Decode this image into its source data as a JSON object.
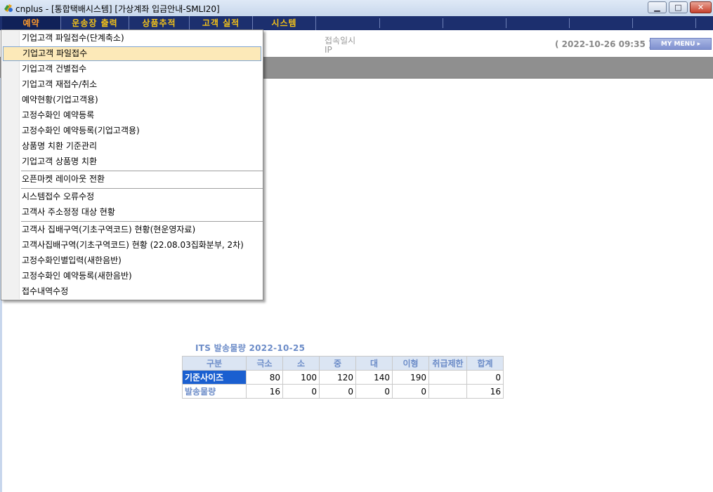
{
  "window": {
    "title": "cnplus - [통합택배시스템] [가상계좌 입금안내-SMLI20]",
    "min_glyph": "▁",
    "max_glyph": "□",
    "close_glyph": "✕"
  },
  "menubar": {
    "items": [
      "예약",
      "운송장 출력",
      "상품추적",
      "고객 실적",
      "시스템"
    ],
    "active": "예약"
  },
  "infobar": {
    "access_label": "접속일시",
    "ip_label": "IP",
    "datetime": "( 2022-10-26 09:35 )",
    "my_menu": "MY MENU ▸"
  },
  "dropdown": {
    "items": [
      "기업고객 파일접수(단계축소)",
      "기업고객 파일접수",
      "기업고객 건별접수",
      "기업고객 재접수/취소",
      "예약현황(기업고객용)",
      "고정수화인 예약등록",
      "고정수화인 예약등록(기업고객용)",
      "상품명 치환 기준관리",
      "기업고객 상품명 치환",
      "오픈마켓 레이아웃 전환",
      "시스템접수 오류수정",
      "고객사 주소정정 대상 현황",
      "고객사 집배구역(기초구역코드) 현황(현운영자료)",
      "고객사집배구역(기초구역코드) 현황 (22.08.03집화분부, 2차)",
      "고정수화인별입력(새한음반)",
      "고정수화인 예약등록(새한음반)",
      "접수내역수정"
    ],
    "hovered_index": 1
  },
  "stats": {
    "title": "ITS 발송물량 2022-10-25",
    "headers": [
      "구분",
      "극소",
      "소",
      "중",
      "대",
      "이형",
      "취급제한",
      "합계"
    ],
    "rows": [
      {
        "label": "기준사이즈",
        "values": [
          "80",
          "100",
          "120",
          "140",
          "190",
          "",
          "0"
        ]
      },
      {
        "label": "발송물량",
        "values": [
          "16",
          "0",
          "0",
          "0",
          "0",
          "",
          "16"
        ]
      }
    ]
  }
}
